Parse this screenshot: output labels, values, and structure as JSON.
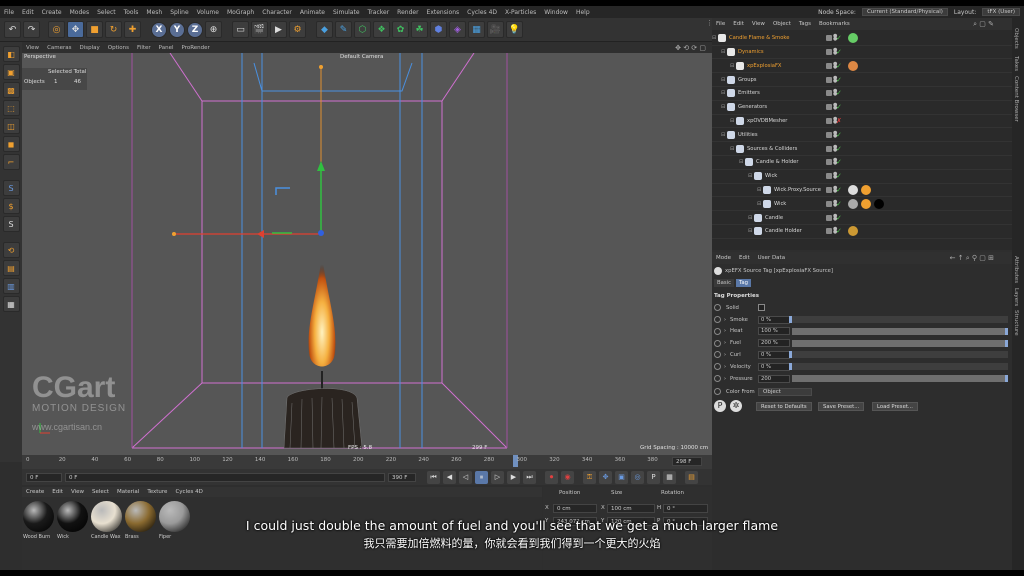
{
  "menubar": {
    "items": [
      "File",
      "Edit",
      "Create",
      "Modes",
      "Select",
      "Tools",
      "Mesh",
      "Spline",
      "Volume",
      "MoGraph",
      "Character",
      "Animate",
      "Simulate",
      "Tracker",
      "Render",
      "Extensions",
      "Cycles 4D",
      "X-Particles",
      "Window",
      "Help"
    ],
    "node_space_label": "Node Space:",
    "node_space_value": "Current (Standard/Physical)",
    "layout_label": "Layout:",
    "layout_value": "tFX (User)"
  },
  "viewport_menu": [
    "View",
    "Cameras",
    "Display",
    "Options",
    "Filter",
    "Panel",
    "ProRender"
  ],
  "viewport": {
    "name": "Perspective",
    "camera": "Default Camera",
    "stats_header": "Selected Total",
    "stats_label": "Objects",
    "stats_selected": "1",
    "stats_total": "46",
    "fps": "FPS : 5.8",
    "frame": "299 F",
    "grid_spacing": "Grid Spacing : 10000 cm"
  },
  "watermark": {
    "brand": "CGart",
    "tagline": "MOTION DESIGN",
    "url": "www.cgartisan.cn"
  },
  "timeline": {
    "ticks": [
      "0",
      "20",
      "40",
      "60",
      "80",
      "100",
      "120",
      "140",
      "160",
      "180",
      "200",
      "220",
      "240",
      "260",
      "280",
      "300",
      "320",
      "340",
      "360",
      "380"
    ],
    "current_frame_box": "298 F",
    "playhead_frame": 299
  },
  "playback": {
    "start_field": "0 F",
    "current_field": "0 F",
    "end_field": "390 F",
    "end_field2": "390 F"
  },
  "material_menu": [
    "Create",
    "Edit",
    "View",
    "Select",
    "Material",
    "Texture",
    "Cycles 4D"
  ],
  "materials": [
    {
      "name": "Wood Burn",
      "color": "#1a1a1a"
    },
    {
      "name": "Wick",
      "color": "#111111"
    },
    {
      "name": "Candle Wax",
      "color": "#e8e0d0"
    },
    {
      "name": "Brass",
      "color": "#8a6a30"
    },
    {
      "name": "Fiper",
      "color": "#9a9a9a"
    }
  ],
  "coords": {
    "headers": [
      "Position",
      "Size",
      "Rotation"
    ],
    "rows": [
      {
        "axis": "X",
        "pos": "0 cm",
        "saxis": "X",
        "size": "100 cm",
        "raxis": "H",
        "rot": "0 °"
      },
      {
        "axis": "Y",
        "pos": "243.072 cm",
        "saxis": "Y",
        "size": "120 cm",
        "raxis": "P",
        "rot": "0 °"
      }
    ]
  },
  "object_manager": {
    "menu": [
      "File",
      "Edit",
      "View",
      "Object",
      "Tags",
      "Bookmarks"
    ],
    "rows": [
      {
        "name": "Candle Flame & Smoke",
        "indent": 0,
        "color": "#f0a030"
      },
      {
        "name": "Dynamics",
        "indent": 1,
        "color": "#f0a030"
      },
      {
        "name": "xpExplosiaFX",
        "indent": 2,
        "color": "#f0a030"
      },
      {
        "name": "Groups",
        "indent": 1,
        "color": "#d8d8d8"
      },
      {
        "name": "Emitters",
        "indent": 1,
        "color": "#d8d8d8"
      },
      {
        "name": "Generators",
        "indent": 1,
        "color": "#d8d8d8"
      },
      {
        "name": "xpOVDBMesher",
        "indent": 2,
        "color": "#d8d8d8"
      },
      {
        "name": "Utilities",
        "indent": 1,
        "color": "#d8d8d8"
      },
      {
        "name": "Sources & Colliders",
        "indent": 2,
        "color": "#d8d8d8"
      },
      {
        "name": "Candle & Holder",
        "indent": 3,
        "color": "#d8d8d8"
      },
      {
        "name": "Wick",
        "indent": 4,
        "color": "#d8d8d8"
      },
      {
        "name": "Wick.Proxy.Source",
        "indent": 5,
        "color": "#d8d8d8"
      },
      {
        "name": "Wick",
        "indent": 5,
        "color": "#d8d8d8"
      },
      {
        "name": "Candle",
        "indent": 4,
        "color": "#d8d8d8"
      },
      {
        "name": "Candle Holder",
        "indent": 4,
        "color": "#d8d8d8"
      }
    ]
  },
  "attributes": {
    "menu": [
      "Mode",
      "Edit",
      "User Data"
    ],
    "title": "xpEFX Source Tag [xpExplosiaFX Source]",
    "tabs": [
      "Basic",
      "Tag"
    ],
    "section": "Tag Properties",
    "solid_label": "Solid",
    "params": [
      {
        "label": "Smoke",
        "value": "0 %",
        "fill": 0.0
      },
      {
        "label": "Heat",
        "value": "100 %",
        "fill": 1.0
      },
      {
        "label": "Fuel",
        "value": "200 %",
        "fill": 1.0
      },
      {
        "label": "Curl",
        "value": "0 %",
        "fill": 0.0
      },
      {
        "label": "Velocity",
        "value": "0 %",
        "fill": 0.0
      },
      {
        "label": "Pressure",
        "value": "200",
        "fill": 1.0
      }
    ],
    "color_from_label": "Color From",
    "color_from_value": "Object",
    "buttons": [
      "Reset to Defaults",
      "Save Preset...",
      "Load Preset..."
    ]
  },
  "right_tabs_top": [
    "Objects",
    "Takes",
    "Content Browser"
  ],
  "right_tabs_bottom": [
    "Attributes",
    "Layers",
    "Structure"
  ],
  "subtitles": {
    "english": "I could just double the amount of fuel and you'll see that we get a much larger flame",
    "chinese": "我只需要加倍燃料的量，你就会看到我们得到一个更大的火焰"
  }
}
